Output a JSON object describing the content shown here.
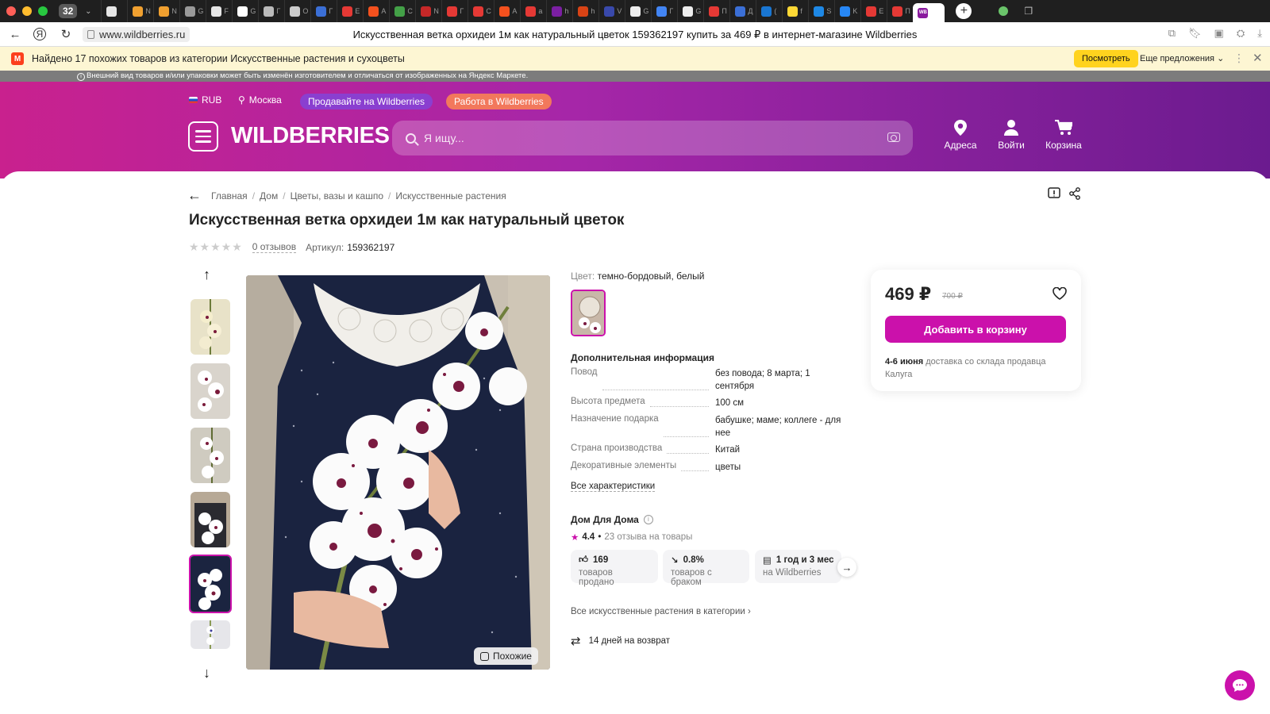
{
  "browser": {
    "tab_count": "32",
    "url": "www.wildberries.ru",
    "page_title": "Искусственная ветка орхидеи 1м как натуральный цветок 159362197 купить за 469 ₽ в интернет-магазине Wildberries",
    "tab_favicons": [
      {
        "color": "#e6e6e6",
        "letter": ""
      },
      {
        "color": "#f0a030",
        "letter": "N"
      },
      {
        "color": "#f0a030",
        "letter": "N"
      },
      {
        "color": "#999999",
        "letter": "G"
      },
      {
        "color": "#e6e6e6",
        "letter": "F"
      },
      {
        "color": "#ffffff",
        "letter": "G"
      },
      {
        "color": "#bbbbbb",
        "letter": "Г"
      },
      {
        "color": "#cccccc",
        "letter": "O"
      },
      {
        "color": "#3b6fd6",
        "letter": "Г"
      },
      {
        "color": "#e53935",
        "letter": "E"
      },
      {
        "color": "#f4511e",
        "letter": "A"
      },
      {
        "color": "#43a047",
        "letter": "C"
      },
      {
        "color": "#c62828",
        "letter": "N"
      },
      {
        "color": "#e53935",
        "letter": "Г"
      },
      {
        "color": "#e53935",
        "letter": "C"
      },
      {
        "color": "#f4511e",
        "letter": "A"
      },
      {
        "color": "#e53935",
        "letter": "a"
      },
      {
        "color": "#7b1fa2",
        "letter": "h"
      },
      {
        "color": "#d84315",
        "letter": "h"
      },
      {
        "color": "#3949ab",
        "letter": "V"
      },
      {
        "color": "#eeeeee",
        "letter": "G"
      },
      {
        "color": "#4285f4",
        "letter": "Г"
      },
      {
        "color": "#eeeeee",
        "letter": "G"
      },
      {
        "color": "#e53935",
        "letter": "П"
      },
      {
        "color": "#3b6fd6",
        "letter": "Д"
      },
      {
        "color": "#1976d2",
        "letter": "("
      },
      {
        "color": "#fdd835",
        "letter": "f"
      },
      {
        "color": "#1e88e5",
        "letter": "S"
      },
      {
        "color": "#2787f5",
        "letter": "K"
      },
      {
        "color": "#e53935",
        "letter": "E"
      },
      {
        "color": "#e53935",
        "letter": "П"
      }
    ],
    "active_tab_icon": "WB"
  },
  "yandex_bar": {
    "text": "Найдено 17 похожих товаров из категории Искусственные растения и сухоцветы",
    "view_button": "Посмотреть",
    "more_offers": "Еще предложения",
    "disclaimer": "Внешний вид товаров и/или упаковки может быть изменён изготовителем и отличаться от изображенных на Яндекс Маркете."
  },
  "header": {
    "currency": "RUB",
    "city": "Москва",
    "sell_pill": "Продавайте на Wildberries",
    "work_pill": "Работа в Wildberries",
    "logo": "WILDBERRIES",
    "search_placeholder": "Я ищу...",
    "addresses": "Адреса",
    "login": "Войти",
    "cart": "Корзина",
    "colors": {
      "pill_sell": "#8a3fd0",
      "pill_work": "#f2785c",
      "accent": "#cb11ab"
    }
  },
  "breadcrumbs": [
    "Главная",
    "Дом",
    "Цветы, вазы и кашпо",
    "Искусственные растения"
  ],
  "product": {
    "title": "Искусственная ветка орхидеи 1м как натуральный цветок",
    "reviews": "0 отзывов",
    "article_label": "Артикул:",
    "article": "159362197",
    "similar_button": "Похожие",
    "color_label": "Цвет:",
    "color_value": "темно-бордовый, белый",
    "additional_title": "Дополнительная информация",
    "specs": [
      {
        "k": "Повод",
        "v": "без повода; 8 марта; 1 сентября"
      },
      {
        "k": "Высота предмета",
        "v": "100 см"
      },
      {
        "k": "Назначение подарка",
        "v": "бабушке; маме; коллеге - для нее"
      },
      {
        "k": "Страна производства",
        "v": "Китай"
      },
      {
        "k": "Декоративные элементы",
        "v": "цветы"
      }
    ],
    "all_characteristics": "Все характеристики",
    "seller_name": "Дом Для Дома",
    "seller_rating": "4.4",
    "seller_reviews": "23 отзыва на товары",
    "stats": [
      {
        "value": "169",
        "label": "товаров продано"
      },
      {
        "value": "0.8%",
        "label": "товаров с браком"
      },
      {
        "value": "1 год и 3 мес",
        "label": "на Wildberries"
      }
    ],
    "all_in_category": "Все искусственные растения в категории",
    "return_info": "14 дней на возврат"
  },
  "price_card": {
    "price": "469 ₽",
    "old_price": "700 ₽",
    "add_to_cart": "Добавить в корзину",
    "delivery_date": "4-6 июня",
    "delivery_text": "доставка со склада продавца Калуга"
  }
}
